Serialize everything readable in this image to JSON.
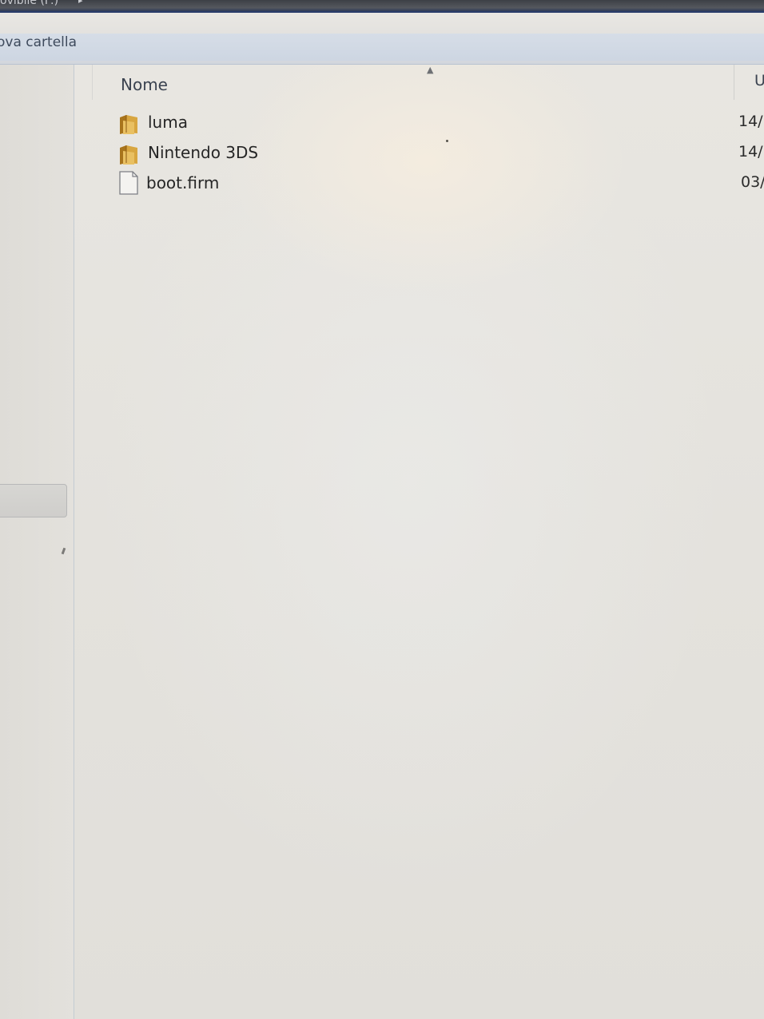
{
  "address_bar": {
    "text": "ovibile (F:)",
    "arrow": "▸"
  },
  "toolbar": {
    "new_folder_label": "ova cartella"
  },
  "columns": {
    "sort_indicator": "▲",
    "name": "Nome",
    "date": "Ulti"
  },
  "items": [
    {
      "name": "luma",
      "date": "14/",
      "icon": "folder-icon"
    },
    {
      "name": "Nintendo 3DS",
      "date": "14/",
      "icon": "folder-icon"
    },
    {
      "name": "boot.firm",
      "date": "03/",
      "icon": "file-icon"
    }
  ],
  "colors": {
    "folder_gold": "#d8a640",
    "folder_dark": "#a8741c",
    "accent_blue": "#2a3d6b"
  }
}
